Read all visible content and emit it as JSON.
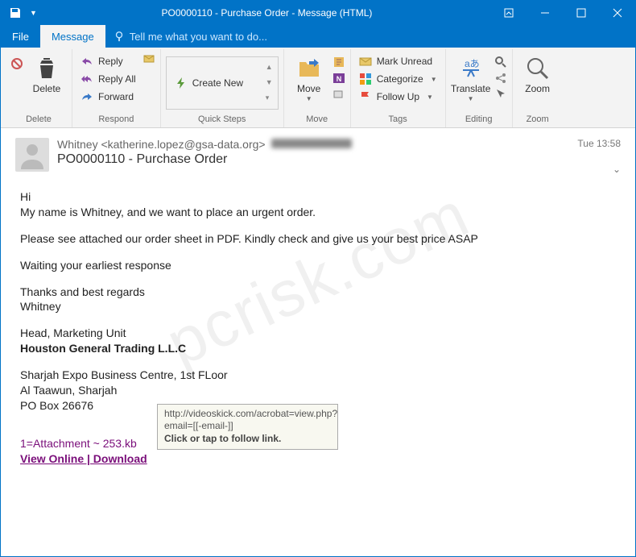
{
  "titlebar": {
    "title": "PO0000110 - Purchase Order  - Message (HTML)"
  },
  "menu": {
    "file": "File",
    "message": "Message",
    "tell": "Tell me what you want to do..."
  },
  "ribbon": {
    "delete_group": "Delete",
    "delete": "Delete",
    "respond_group": "Respond",
    "reply": "Reply",
    "reply_all": "Reply All",
    "forward": "Forward",
    "quicksteps_group": "Quick Steps",
    "create_new": "Create New",
    "move_group": "Move",
    "move": "Move",
    "tags_group": "Tags",
    "mark_unread": "Mark Unread",
    "categorize": "Categorize",
    "follow_up": "Follow Up",
    "editing_group": "Editing",
    "translate": "Translate",
    "zoom_group": "Zoom",
    "zoom": "Zoom"
  },
  "header": {
    "sender": "Whitney <katherine.lopez@gsa-data.org>",
    "subject": "PO0000110 - Purchase Order",
    "time": "Tue 13:58"
  },
  "body": {
    "l1": "Hi",
    "l2": "My name is Whitney, and we want to place an urgent order.",
    "l3": "Please see attached our order sheet in PDF. Kindly check and give us your best price ASAP",
    "l4": "Waiting your earliest response",
    "l5": "Thanks and best regards",
    "l6": "Whitney",
    "l7": "Head, Marketing Unit",
    "l8": "Houston General Trading L.L.C",
    "l9": "Sharjah Expo Business Centre, 1st FLoor",
    "l10": "Al Taawun, Sharjah",
    "l11": "PO Box 26676",
    "attach_info": "1=Attachment ~ 253.kb",
    "attach_link": "View Online | Download"
  },
  "tooltip": {
    "url": "http://videoskick.com/acrobat=view.php?email=[[-email-]]",
    "hint": "Click or tap to follow link."
  },
  "watermark": "pcrisk.com"
}
